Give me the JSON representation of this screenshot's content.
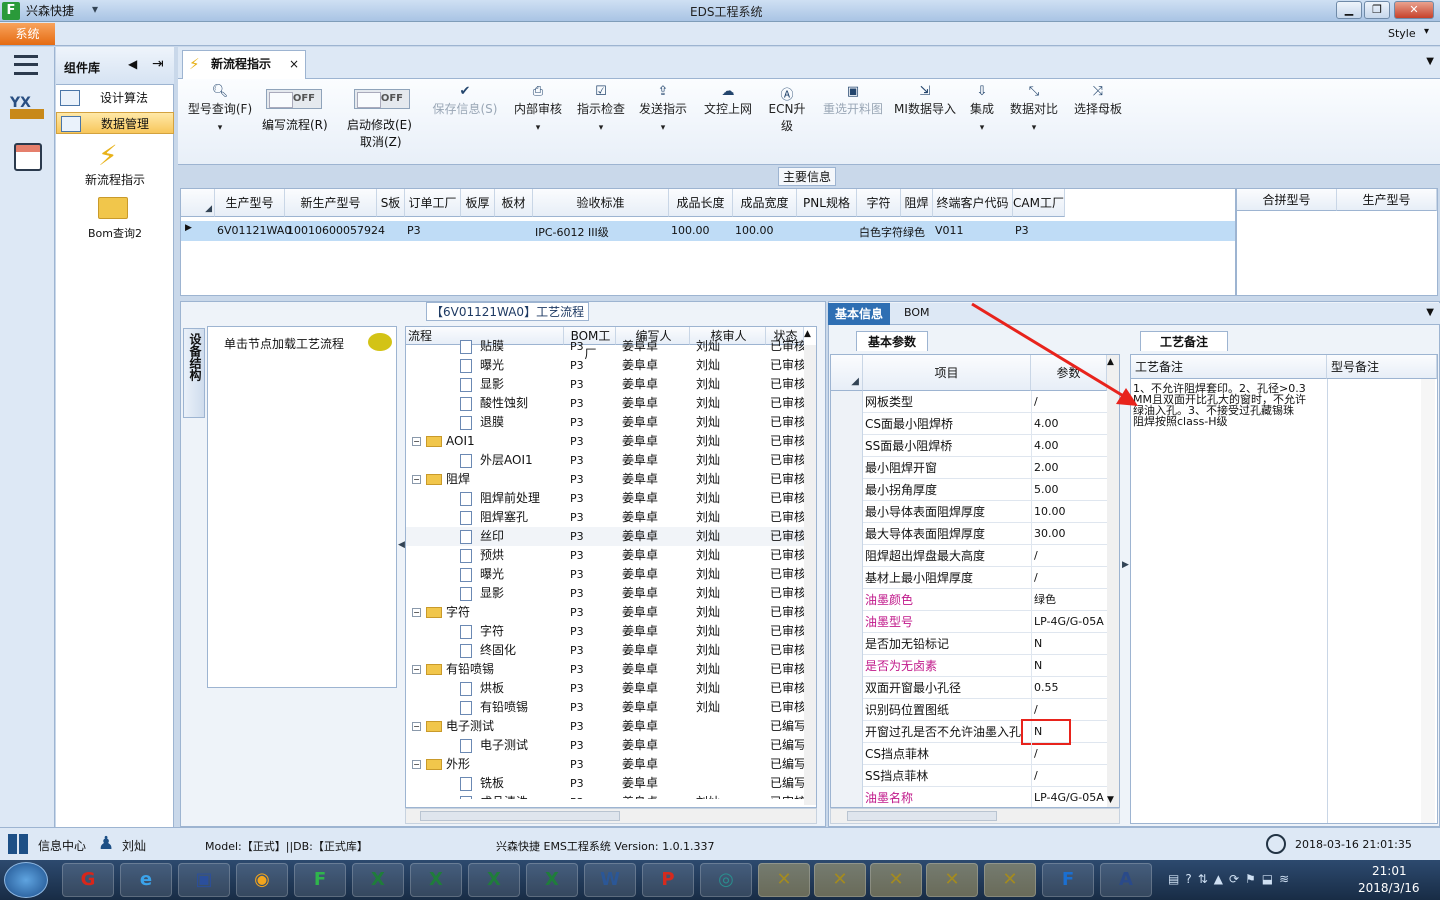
{
  "window": {
    "app_name": "兴森快捷",
    "title": "EDS工程系统",
    "style_label": "Style"
  },
  "menu": {
    "system": "系统"
  },
  "components": {
    "header": "组件库",
    "items": [
      {
        "label": "设计算法"
      },
      {
        "label": "数据管理"
      }
    ],
    "icons": [
      {
        "label": "新流程指示"
      },
      {
        "label": "Bom查询2"
      }
    ]
  },
  "tab": {
    "label": "新流程指示"
  },
  "toolbar": {
    "query": "型号查询(F)",
    "write_flow": "编写流程(R)",
    "start_modify": "启动修改(E)",
    "cancel": "取消(Z)",
    "toggle_off": "OFF",
    "buttons": [
      {
        "label": "保存信息(S)",
        "icon": "check",
        "disabled": true
      },
      {
        "label": "内部审核",
        "icon": "printer"
      },
      {
        "label": "指示检查",
        "icon": "check-box"
      },
      {
        "label": "发送指示",
        "icon": "upload"
      },
      {
        "label": "文控上网",
        "icon": "cloud-upload"
      },
      {
        "label": "ECN升级",
        "icon": "ecn"
      },
      {
        "label": "重选开料图",
        "icon": "image",
        "disabled": true
      },
      {
        "label": "MI数据导入",
        "icon": "import"
      },
      {
        "label": "集成",
        "icon": "download"
      },
      {
        "label": "数据对比",
        "icon": "compare"
      },
      {
        "label": "选择母板",
        "icon": "shuffle"
      }
    ]
  },
  "main_info": {
    "title": "主要信息",
    "columns": [
      "生产型号",
      "新生产型号",
      "S板",
      "订单工厂",
      "板厚",
      "板材",
      "验收标准",
      "成品长度",
      "成品宽度",
      "PNL规格",
      "字符",
      "阻焊",
      "终端客户代码",
      "CAM工厂"
    ],
    "row": [
      "6V01121WA0",
      "10010600057924",
      "",
      "P3",
      "",
      "",
      "IPC-6012 III级",
      "100.00",
      "100.00",
      "",
      "白色字符",
      "绿色",
      "V011",
      "P3"
    ],
    "side_columns": [
      "合拼型号",
      "生产型号"
    ]
  },
  "flow": {
    "title": "【6V01121WA0】工艺流程",
    "side_tab": "设备结构",
    "hint": "单击节点加载工艺流程",
    "columns": [
      "流程",
      "BOM工厂",
      "编写人",
      "核审人",
      "状态"
    ],
    "rows": [
      {
        "name": "贴膜",
        "level": 2,
        "folder": false,
        "bom": "P3",
        "writer": "姜阜卓",
        "auditor": "刘灿",
        "status": "已审核"
      },
      {
        "name": "曝光",
        "level": 2,
        "folder": false,
        "bom": "P3",
        "writer": "姜阜卓",
        "auditor": "刘灿",
        "status": "已审核"
      },
      {
        "name": "显影",
        "level": 2,
        "folder": false,
        "bom": "P3",
        "writer": "姜阜卓",
        "auditor": "刘灿",
        "status": "已审核"
      },
      {
        "name": "酸性蚀刻",
        "level": 2,
        "folder": false,
        "bom": "P3",
        "writer": "姜阜卓",
        "auditor": "刘灿",
        "status": "已审核"
      },
      {
        "name": "退膜",
        "level": 2,
        "folder": false,
        "bom": "P3",
        "writer": "姜阜卓",
        "auditor": "刘灿",
        "status": "已审核"
      },
      {
        "name": "AOI1",
        "level": 1,
        "folder": true,
        "bom": "P3",
        "writer": "姜阜卓",
        "auditor": "刘灿",
        "status": "已审核"
      },
      {
        "name": "外层AOI1",
        "level": 2,
        "folder": false,
        "bom": "P3",
        "writer": "姜阜卓",
        "auditor": "刘灿",
        "status": "已审核"
      },
      {
        "name": "阻焊",
        "level": 1,
        "folder": true,
        "bom": "P3",
        "writer": "姜阜卓",
        "auditor": "刘灿",
        "status": "已审核"
      },
      {
        "name": "阻焊前处理",
        "level": 2,
        "folder": false,
        "bom": "P3",
        "writer": "姜阜卓",
        "auditor": "刘灿",
        "status": "已审核"
      },
      {
        "name": "阻焊塞孔",
        "level": 2,
        "folder": false,
        "bom": "P3",
        "writer": "姜阜卓",
        "auditor": "刘灿",
        "status": "已审核"
      },
      {
        "name": "丝印",
        "level": 2,
        "folder": false,
        "bom": "P3",
        "writer": "姜阜卓",
        "auditor": "刘灿",
        "status": "已审核",
        "selected": true
      },
      {
        "name": "预烘",
        "level": 2,
        "folder": false,
        "bom": "P3",
        "writer": "姜阜卓",
        "auditor": "刘灿",
        "status": "已审核"
      },
      {
        "name": "曝光",
        "level": 2,
        "folder": false,
        "bom": "P3",
        "writer": "姜阜卓",
        "auditor": "刘灿",
        "status": "已审核"
      },
      {
        "name": "显影",
        "level": 2,
        "folder": false,
        "bom": "P3",
        "writer": "姜阜卓",
        "auditor": "刘灿",
        "status": "已审核"
      },
      {
        "name": "字符",
        "level": 1,
        "folder": true,
        "bom": "P3",
        "writer": "姜阜卓",
        "auditor": "刘灿",
        "status": "已审核"
      },
      {
        "name": "字符",
        "level": 2,
        "folder": false,
        "bom": "P3",
        "writer": "姜阜卓",
        "auditor": "刘灿",
        "status": "已审核"
      },
      {
        "name": "终固化",
        "level": 2,
        "folder": false,
        "bom": "P3",
        "writer": "姜阜卓",
        "auditor": "刘灿",
        "status": "已审核"
      },
      {
        "name": "有铅喷锡",
        "level": 1,
        "folder": true,
        "bom": "P3",
        "writer": "姜阜卓",
        "auditor": "刘灿",
        "status": "已审核"
      },
      {
        "name": "烘板",
        "level": 2,
        "folder": false,
        "bom": "P3",
        "writer": "姜阜卓",
        "auditor": "刘灿",
        "status": "已审核"
      },
      {
        "name": "有铅喷锡",
        "level": 2,
        "folder": false,
        "bom": "P3",
        "writer": "姜阜卓",
        "auditor": "刘灿",
        "status": "已审核"
      },
      {
        "name": "电子测试",
        "level": 1,
        "folder": true,
        "bom": "P3",
        "writer": "姜阜卓",
        "auditor": "",
        "status": "已编写"
      },
      {
        "name": "电子测试",
        "level": 2,
        "folder": false,
        "bom": "P3",
        "writer": "姜阜卓",
        "auditor": "",
        "status": "已编写"
      },
      {
        "name": "外形",
        "level": 1,
        "folder": true,
        "bom": "P3",
        "writer": "姜阜卓",
        "auditor": "",
        "status": "已编写"
      },
      {
        "name": "铣板",
        "level": 2,
        "folder": false,
        "bom": "P3",
        "writer": "姜阜卓",
        "auditor": "",
        "status": "已编写"
      },
      {
        "name": "成品清洗",
        "level": 2,
        "folder": false,
        "bom": "P3",
        "writer": "姜阜卓",
        "auditor": "刘灿",
        "status": "已审核"
      }
    ]
  },
  "basic": {
    "tabs": [
      "基本信息",
      "BOM"
    ],
    "subtab": "基本参数",
    "columns": [
      "项目",
      "参数"
    ],
    "rows": [
      {
        "item": "网板类型",
        "value": "/",
        "highlight": false
      },
      {
        "item": "CS面最小阻焊桥",
        "value": "4.00",
        "highlight": false
      },
      {
        "item": "SS面最小阻焊桥",
        "value": "4.00",
        "highlight": false
      },
      {
        "item": "最小阻焊开窗",
        "value": "2.00",
        "highlight": false
      },
      {
        "item": "最小拐角厚度",
        "value": "5.00",
        "highlight": false
      },
      {
        "item": "最小导体表面阻焊厚度",
        "value": "10.00",
        "highlight": false
      },
      {
        "item": "最大导体表面阻焊厚度",
        "value": "30.00",
        "highlight": false
      },
      {
        "item": "阻焊超出焊盘最大高度",
        "value": "/",
        "highlight": false
      },
      {
        "item": "基材上最小阻焊厚度",
        "value": "/",
        "highlight": false
      },
      {
        "item": "油墨颜色",
        "value": "绿色",
        "highlight": true
      },
      {
        "item": "油墨型号",
        "value": "LP-4G/G-05A",
        "highlight": true
      },
      {
        "item": "是否加无铅标记",
        "value": "N",
        "highlight": false
      },
      {
        "item": "是否为无卤素",
        "value": "N",
        "highlight": true
      },
      {
        "item": "双面开窗最小孔径",
        "value": "0.55",
        "highlight": false
      },
      {
        "item": "识别码位置图纸",
        "value": "/",
        "highlight": false
      },
      {
        "item": "开窗过孔是否不允许油墨入孔",
        "value": "N",
        "highlight": false,
        "boxed": true
      },
      {
        "item": "CS挡点菲林",
        "value": "/",
        "highlight": false
      },
      {
        "item": "SS挡点菲林",
        "value": "/",
        "highlight": false
      },
      {
        "item": "油墨名称",
        "value": "LP-4G/G-05A",
        "highlight": true
      }
    ]
  },
  "remarks": {
    "tab": "工艺备注",
    "columns": [
      "工艺备注",
      "型号备注"
    ],
    "text": "1、不允许阻焊套印。2、孔径>0.3MM且双面开比孔大的窗时，不允许绿油入孔。3、不接受过孔藏锡珠\n阻焊按照class-H级"
  },
  "status": {
    "user_label": "信息中心",
    "user": "刘灿",
    "model": "Model:【正式】||DB:【正式库】",
    "center": "兴森快捷 EMS工程系统 Version: 1.0.1.337",
    "datetime": "2018-03-16 21:01:35"
  },
  "taskbar": {
    "time": "21:01",
    "date": "2018/3/16"
  },
  "colors": {
    "highlight_text": "#c0188a",
    "annotation": "#e8231c",
    "selected_row": "#bfdcf6"
  }
}
